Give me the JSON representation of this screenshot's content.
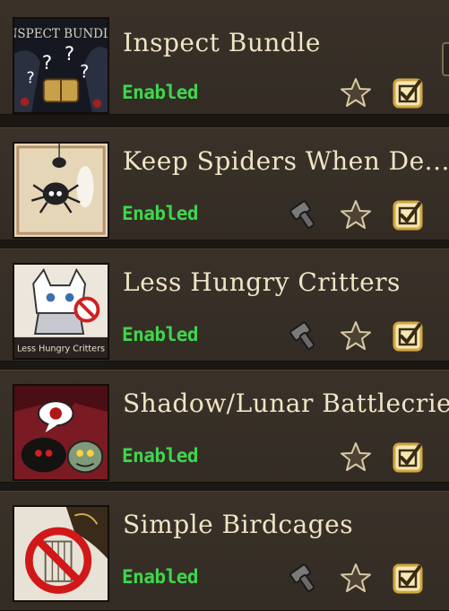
{
  "mods": [
    {
      "title": "Inspect Bundle",
      "status": "Enabled",
      "icon": "inspect-bundle-thumbnail",
      "has_config": false,
      "thumb_text": "INSPECT BUNDLE"
    },
    {
      "title": "Keep Spiders When De...",
      "status": "Enabled",
      "icon": "keep-spiders-thumbnail",
      "has_config": true
    },
    {
      "title": "Less Hungry Critters",
      "status": "Enabled",
      "icon": "less-hungry-critters-thumbnail",
      "has_config": true,
      "thumb_text": "Less Hungry Critters"
    },
    {
      "title": "Shadow/Lunar Battlecries",
      "status": "Enabled",
      "icon": "shadow-lunar-battlecries-thumbnail",
      "has_config": false
    },
    {
      "title": "Simple Birdcages",
      "status": "Enabled",
      "icon": "simple-birdcages-thumbnail",
      "has_config": true
    }
  ],
  "colors": {
    "status_enabled": "#3ed64e",
    "title": "#f0e4c6",
    "panel": "#3a3229"
  },
  "icons": {
    "config": "wrench-icon",
    "favorite": "star-icon",
    "enabled": "checkbox-checked-icon"
  }
}
